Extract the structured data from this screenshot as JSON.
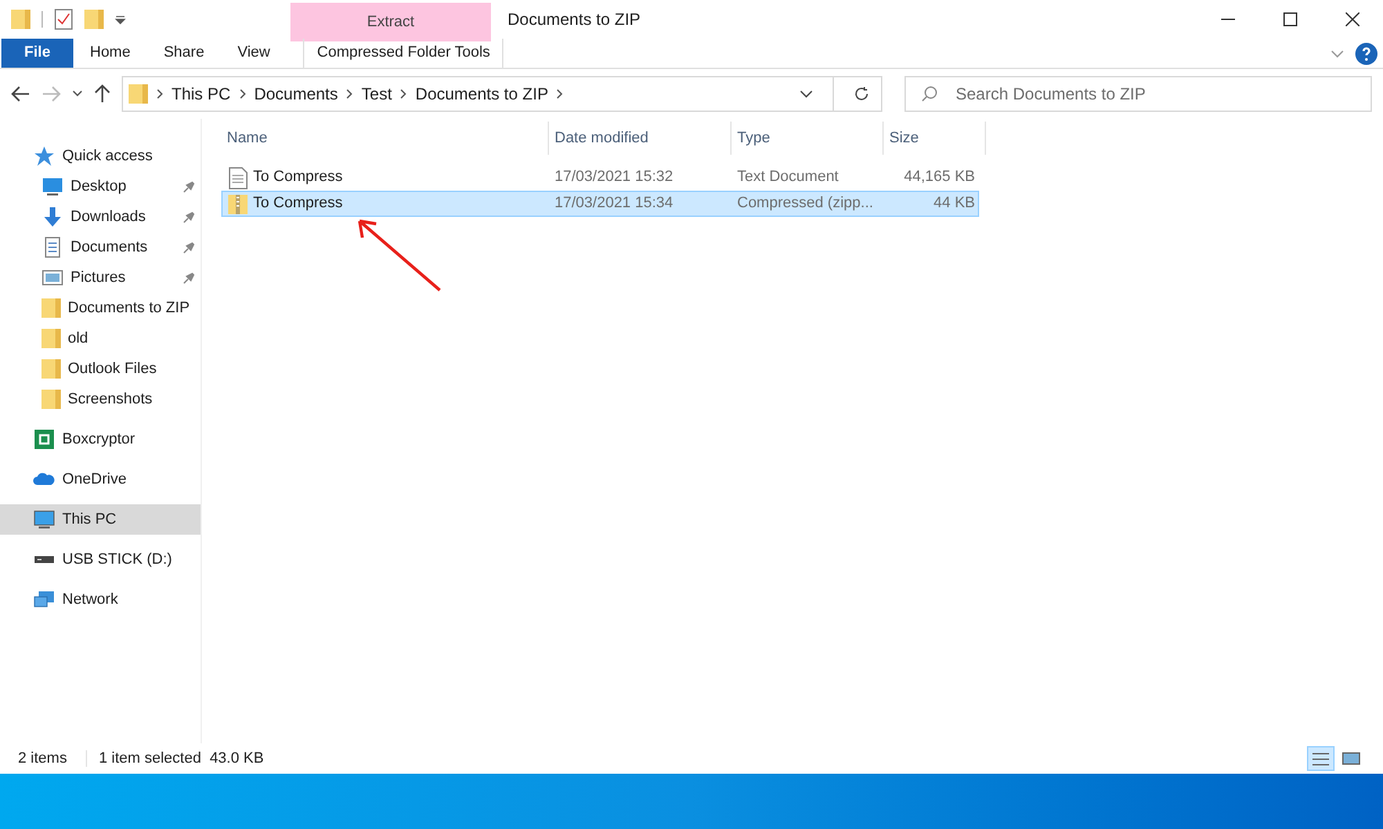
{
  "window": {
    "title": "Documents to ZIP"
  },
  "context_tab": {
    "group": "Extract",
    "label": "Compressed Folder Tools"
  },
  "ribbon_tabs": [
    {
      "label": "File",
      "kind": "file",
      "selected": false
    },
    {
      "label": "Home",
      "kind": "tab",
      "selected": false
    },
    {
      "label": "Share",
      "kind": "tab",
      "selected": false
    },
    {
      "label": "View",
      "kind": "tab",
      "selected": false
    }
  ],
  "address": {
    "path": [
      "This PC",
      "Documents",
      "Test",
      "Documents to ZIP"
    ]
  },
  "search": {
    "placeholder": "Search Documents to ZIP"
  },
  "sidebar": {
    "items": [
      {
        "label": "Quick access",
        "kind": "star",
        "pinned": false,
        "selected": false,
        "children": [
          {
            "label": "Desktop",
            "kind": "desktop",
            "pinned": true,
            "selected": false
          },
          {
            "label": "Downloads",
            "kind": "download",
            "pinned": true,
            "selected": false
          },
          {
            "label": "Documents",
            "kind": "document",
            "pinned": true,
            "selected": false
          },
          {
            "label": "Pictures",
            "kind": "pictures",
            "pinned": true,
            "selected": false
          },
          {
            "label": "Documents to ZIP",
            "kind": "folder",
            "pinned": false,
            "selected": false
          },
          {
            "label": "old",
            "kind": "folder",
            "pinned": false,
            "selected": false
          },
          {
            "label": "Outlook Files",
            "kind": "folder",
            "pinned": false,
            "selected": false
          },
          {
            "label": "Screenshots",
            "kind": "folder",
            "pinned": false,
            "selected": false
          }
        ]
      },
      {
        "label": "Boxcryptor",
        "kind": "boxcryptor",
        "pinned": false,
        "selected": false
      },
      {
        "label": "OneDrive",
        "kind": "cloud",
        "pinned": false,
        "selected": false
      },
      {
        "label": "This PC",
        "kind": "pc",
        "pinned": false,
        "selected": true
      },
      {
        "label": "USB STICK (D:)",
        "kind": "usb",
        "pinned": false,
        "selected": false
      },
      {
        "label": "Network",
        "kind": "network",
        "pinned": false,
        "selected": false
      }
    ]
  },
  "table": {
    "columns": [
      "Name",
      "Date modified",
      "Type",
      "Size"
    ],
    "rows": [
      {
        "kind": "text",
        "name": "To Compress",
        "date": "17/03/2021 15:32",
        "type": "Text Document",
        "size": "44,165 KB",
        "selected": false
      },
      {
        "kind": "zip",
        "name": "To Compress",
        "date": "17/03/2021 15:34",
        "type": "Compressed (zipp...",
        "size": "44 KB",
        "selected": true
      }
    ]
  },
  "status_bar": {
    "count": "2 items",
    "selection": "1 item selected  43.0 KB",
    "views": [
      {
        "kind": "details",
        "selected": true
      },
      {
        "kind": "large",
        "selected": false
      }
    ]
  }
}
